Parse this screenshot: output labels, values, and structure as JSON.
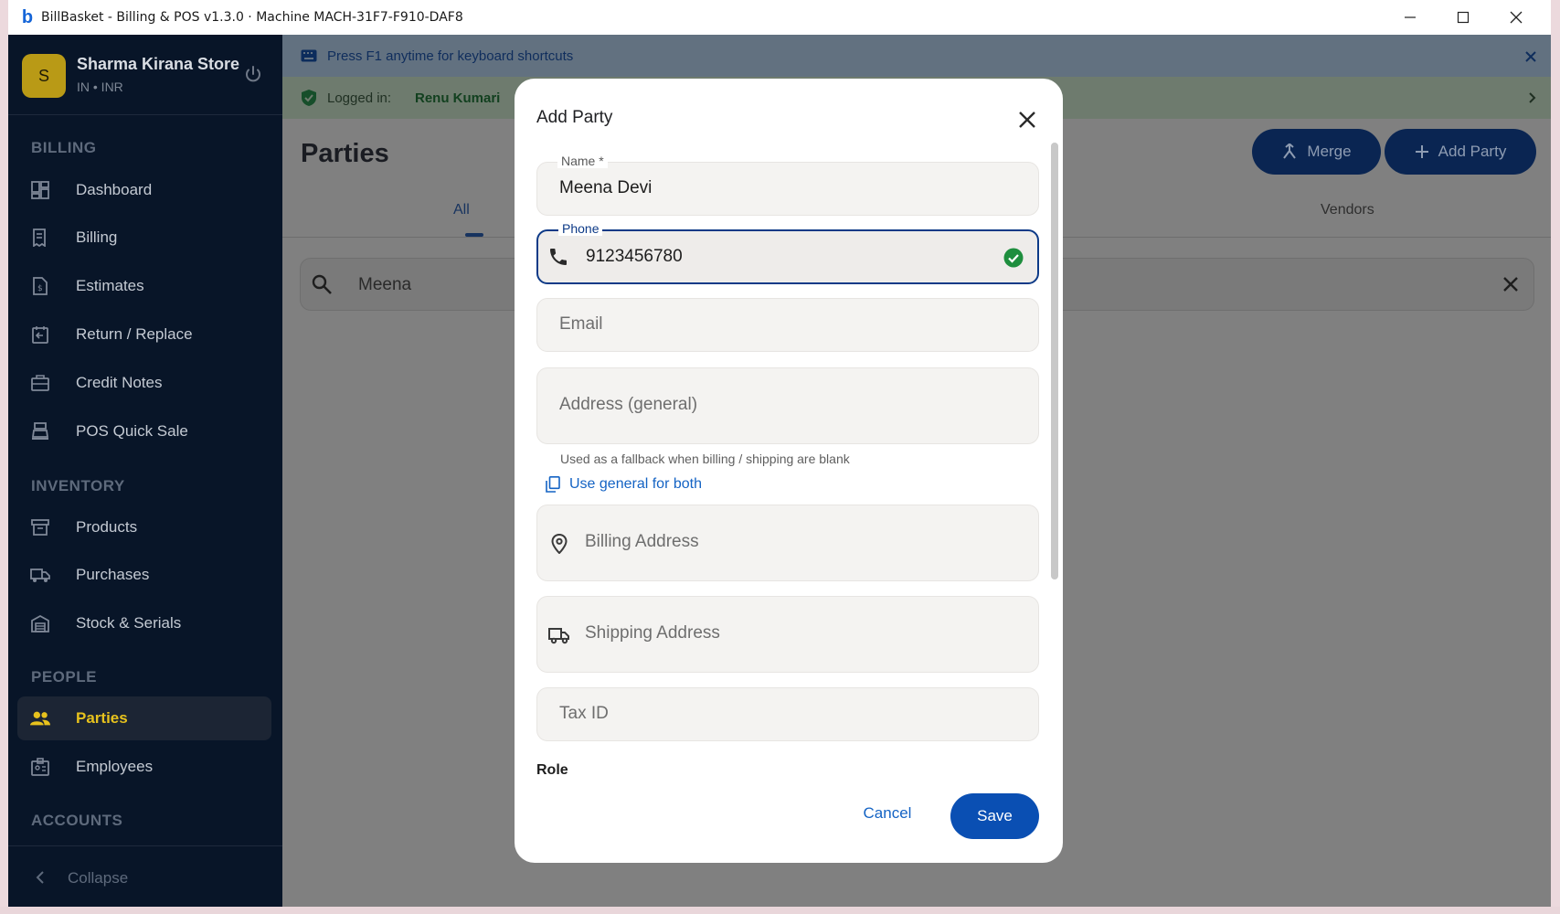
{
  "window": {
    "title": "BillBasket - Billing & POS  v1.3.0  ·  Machine MACH-31F7-F910-DAF8",
    "logo_letter": "b"
  },
  "sidebar": {
    "store_initial": "S",
    "store_name": "Sharma Kirana Store",
    "store_sub": "IN • INR",
    "sections": {
      "billing": "BILLING",
      "inventory": "INVENTORY",
      "people": "PEOPLE",
      "accounts": "ACCOUNTS"
    },
    "items": [
      {
        "label": "Dashboard",
        "icon": "dashboard-icon"
      },
      {
        "label": "Billing",
        "icon": "receipt-icon"
      },
      {
        "label": "Estimates",
        "icon": "estimate-icon"
      },
      {
        "label": "Return / Replace",
        "icon": "return-icon"
      },
      {
        "label": "Credit Notes",
        "icon": "credit-note-icon"
      },
      {
        "label": "POS Quick Sale",
        "icon": "pos-icon"
      },
      {
        "label": "Products",
        "icon": "box-icon"
      },
      {
        "label": "Purchases",
        "icon": "truck-icon"
      },
      {
        "label": "Stock & Serials",
        "icon": "warehouse-icon"
      },
      {
        "label": "Parties",
        "icon": "people-icon",
        "active": true
      },
      {
        "label": "Employees",
        "icon": "badge-icon"
      }
    ],
    "collapse_label": "Collapse"
  },
  "main": {
    "shortcut_banner": "Press F1 anytime for keyboard shortcuts",
    "logged_in_label": "Logged in:",
    "logged_in_user": "Renu Kumari",
    "page_title": "Parties",
    "merge_label": "Merge",
    "add_party_label": "Add Party",
    "tabs": [
      "All",
      "Vendors"
    ],
    "search_value": "Meena"
  },
  "modal": {
    "title": "Add Party",
    "name_label": "Name *",
    "name_value": "Meena Devi",
    "phone_label": "Phone",
    "phone_value": "9123456780",
    "email_placeholder": "Email",
    "address_placeholder": "Address (general)",
    "address_helper": "Used as a fallback when billing / shipping are blank",
    "use_general_label": "Use general for both",
    "billing_placeholder": "Billing Address",
    "shipping_placeholder": "Shipping Address",
    "tax_placeholder": "Tax ID",
    "role_label": "Role",
    "cancel_label": "Cancel",
    "save_label": "Save"
  },
  "colors": {
    "sidebar_bg": "#081528",
    "accent_yellow": "#e7c21d",
    "primary_blue": "#0a4fb3",
    "link_blue": "#1463c4",
    "valid_green": "#1e8e3e"
  }
}
